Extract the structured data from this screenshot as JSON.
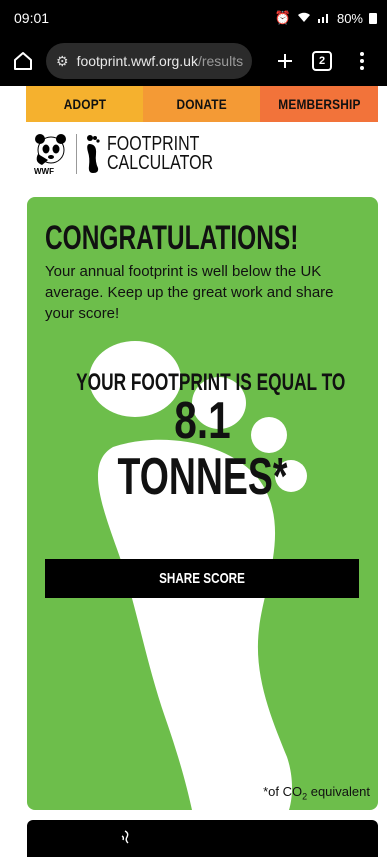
{
  "status_bar": {
    "time": "09:01",
    "battery": "80%"
  },
  "browser": {
    "url_domain": "footprint.wwf.org.uk",
    "url_path": "/results",
    "tab_count": "2"
  },
  "nav": {
    "adopt": "ADOPT",
    "donate": "DONATE",
    "membership": "MEMBERSHIP"
  },
  "logo": {
    "org": "WWF",
    "title_line1": "FOOTPRINT",
    "title_line2": "CALCULATOR"
  },
  "result": {
    "heading": "CONGRATULATIONS!",
    "message": "Your annual footprint is well below the UK average. Keep up the great work and share your score!",
    "equal_to": "YOUR FOOTPRINT IS EQUAL TO",
    "value": "8.1",
    "unit": "TONNES*",
    "share_label": "SHARE SCORE",
    "footnote_prefix": "*of CO",
    "footnote_sub": "2",
    "footnote_suffix": " equivalent"
  },
  "colors": {
    "adopt": "#f5b12e",
    "donate": "#f49a35",
    "membership": "#f2733a",
    "card_green": "#6dbe4b"
  }
}
